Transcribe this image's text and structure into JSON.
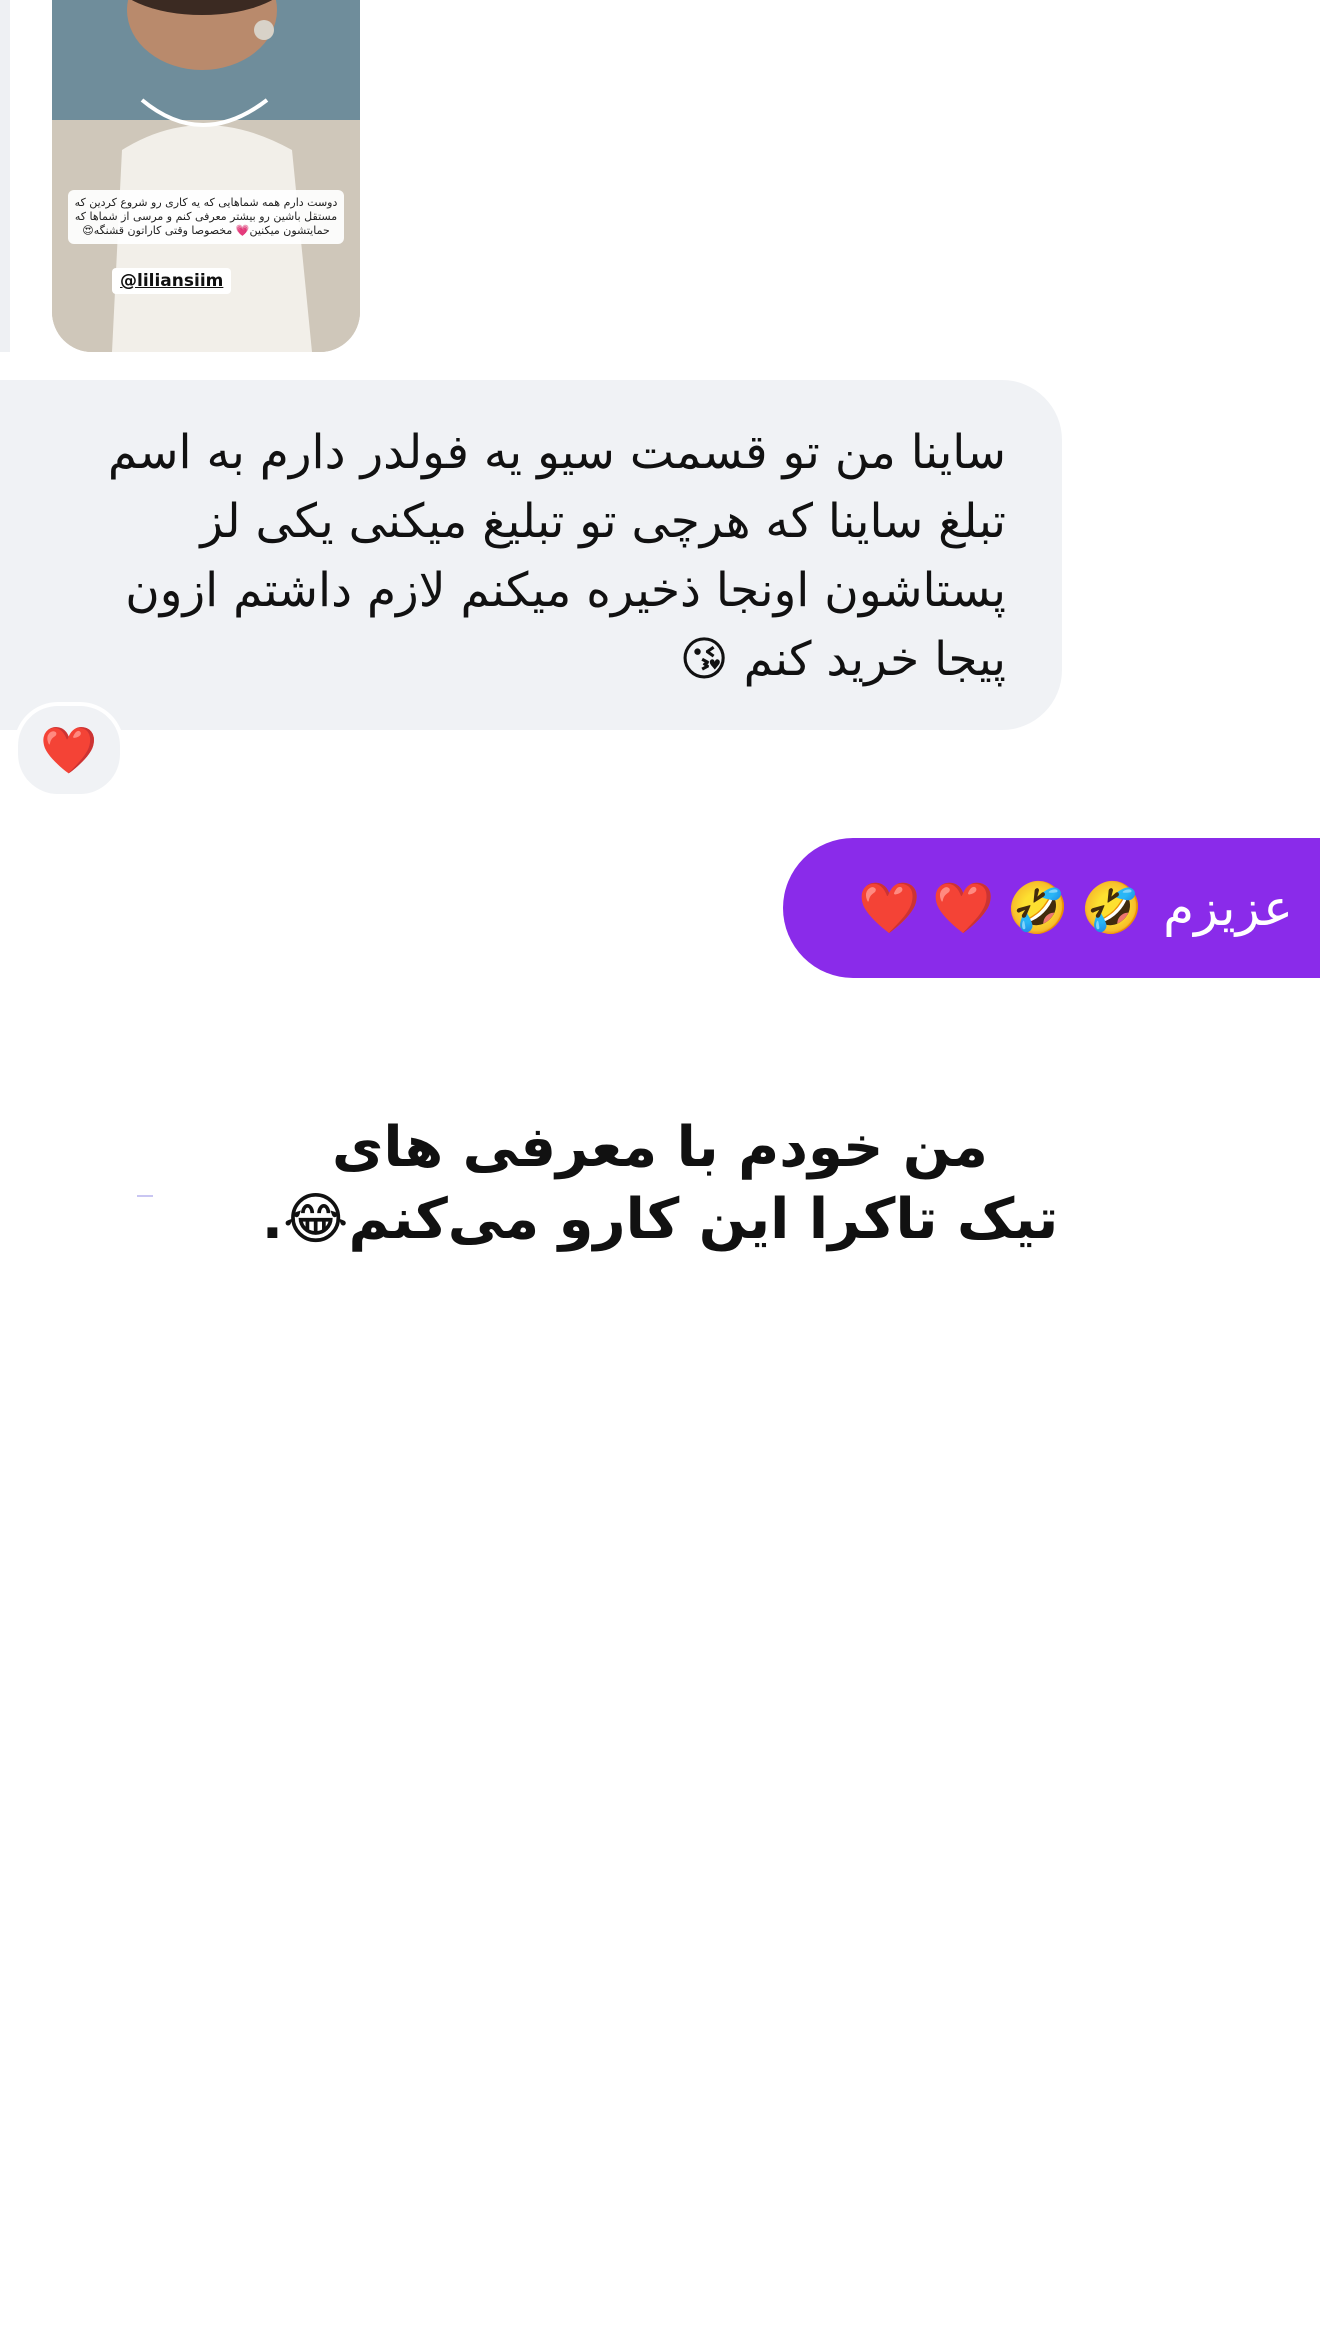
{
  "story": {
    "caption": "دوست دارم همه شماهایی که یه کاری رو شروع کردین که مستقل باشین رو بیشتر معرفی کنم و مرسی از شماها که حمایتشون میکنین💗 مخصوصا وقتی کاراتون قشنگه😍",
    "handle": "@liliansiim"
  },
  "incoming_message": {
    "text": "ساینا من تو قسمت سیو یه فولدر دارم به اسم\nتبلغ ساینا که هرچی تو تبلیغ میکنی یکی لز\nپستاشون اونجا ذخیره میکنم لازم داشتم ازون\nپیجا خرید کنم 😘",
    "reaction": "❤️"
  },
  "outgoing_message": {
    "text": "عزیزم",
    "emojis": [
      "🤣",
      "🤣",
      "❤️",
      "❤️"
    ]
  },
  "overlay_caption": {
    "text": "من خودم با معرفی های\nتیک تاکرا این کارو می‌کنم😂."
  },
  "colors": {
    "outgoing_bubble": "#8a2bea",
    "incoming_bubble": "#f0f2f5"
  }
}
